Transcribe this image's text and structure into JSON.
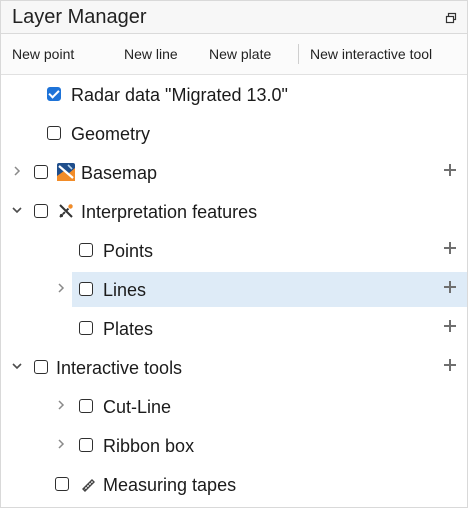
{
  "window": {
    "title": "Layer Manager",
    "undock_icon": "window-restore-icon"
  },
  "toolbar": {
    "new_point": "New point",
    "new_line": "New line",
    "new_plate": "New plate",
    "new_interactive_tool": "New interactive tool"
  },
  "tree": {
    "radar_data": {
      "label": "Radar data \"Migrated 13.0\"",
      "checked": true
    },
    "geometry": {
      "label": "Geometry",
      "checked": false
    },
    "basemap": {
      "label": "Basemap",
      "checked": false,
      "icon": "basemap-icon"
    },
    "interpretation_features": {
      "label": "Interpretation features",
      "checked": false,
      "icon": "interpretation-features-icon"
    },
    "points": {
      "label": "Points",
      "checked": false
    },
    "lines": {
      "label": "Lines",
      "checked": false,
      "selected": true
    },
    "plates": {
      "label": "Plates",
      "checked": false
    },
    "interactive_tools": {
      "label": "Interactive tools",
      "checked": false
    },
    "cut_line": {
      "label": "Cut-Line",
      "checked": false
    },
    "ribbon_box": {
      "label": "Ribbon box",
      "checked": false
    },
    "measuring_tapes": {
      "label": "Measuring tapes",
      "checked": false,
      "icon": "measuring-tape-icon"
    }
  },
  "colors": {
    "selection": "#deebf7",
    "checkbox_checked": "#1e73d8",
    "text": "#1b1b1b",
    "muted": "#8a8a8a"
  }
}
